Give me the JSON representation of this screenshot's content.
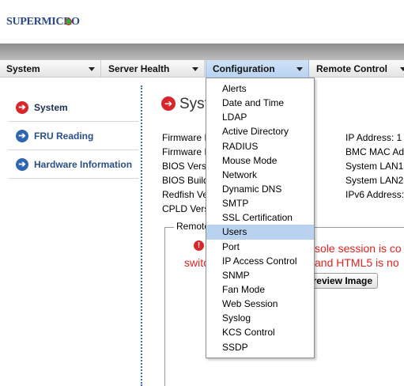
{
  "brand": {
    "logo_text": "SUPERMICRO"
  },
  "nav": {
    "items": [
      {
        "label": "System"
      },
      {
        "label": "Server Health"
      },
      {
        "label": "Configuration"
      },
      {
        "label": "Remote Control"
      }
    ]
  },
  "sidebar": {
    "items": [
      {
        "label": "System",
        "active": true
      },
      {
        "label": "FRU Reading"
      },
      {
        "label": "Hardware Information"
      }
    ]
  },
  "main": {
    "title": "Syst",
    "left_labels": [
      "Firmware I",
      "Firmware I",
      "BIOS Versi",
      "BIOS Build",
      "Redfish Ve",
      "CPLD Vers"
    ],
    "right_labels": [
      "IP Address:  1",
      "BMC MAC Ad",
      "System LAN1",
      "System LAN2",
      "IPv6 Address:"
    ],
    "remote_legend": "Remote",
    "warning_line1": "sole session is co",
    "warning_line2_prefix": "switc",
    "warning_line2_suffix": "and HTML5 is no",
    "preview_button": "review Image"
  },
  "config_menu": {
    "items": [
      "Alerts",
      "Date and Time",
      "LDAP",
      "Active Directory",
      "RADIUS",
      "Mouse Mode",
      "Network",
      "Dynamic DNS",
      "SMTP",
      "SSL Certification",
      "Users",
      "Port",
      "IP Access Control",
      "SNMP",
      "Fan Mode",
      "Web Session",
      "Syslog",
      "KCS Control",
      "SSDP"
    ],
    "highlighted": "Users"
  },
  "colors": {
    "accent": "#2a4f8a",
    "menu_highlight": "#b9d2f0",
    "warning": "#e0231f"
  }
}
